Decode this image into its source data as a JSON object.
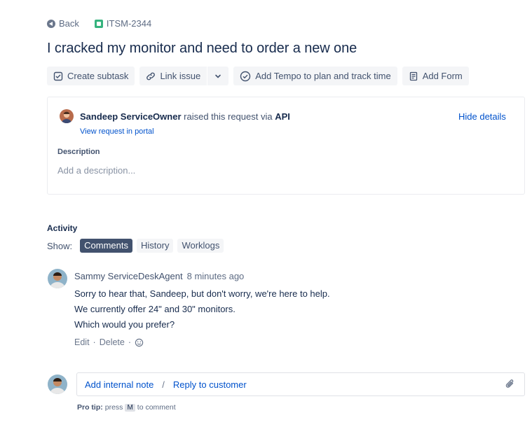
{
  "breadcrumb": {
    "back_label": "Back",
    "issue_key": "ITSM-2344"
  },
  "issue": {
    "title": "I cracked my monitor and need to order a new one"
  },
  "toolbar": {
    "create_subtask": "Create subtask",
    "link_issue": "Link issue",
    "add_tempo": "Add Tempo to plan and track time",
    "add_form": "Add Form"
  },
  "details": {
    "reporter": "Sandeep ServiceOwner",
    "raised_text": "raised this request via",
    "channel": "API",
    "view_portal": "View request in portal",
    "hide_details": "Hide details",
    "description_label": "Description",
    "description_placeholder": "Add a description..."
  },
  "activity": {
    "label": "Activity",
    "show_label": "Show:",
    "tabs": [
      "Comments",
      "History",
      "Worklogs"
    ],
    "active_tab": "Comments"
  },
  "comment": {
    "author": "Sammy ServiceDeskAgent",
    "time": "8 minutes ago",
    "lines": [
      "Sorry to hear that, Sandeep, but don't worry, we're here to help.",
      "We currently offer 24\" and 30\" monitors.",
      "Which would you prefer?"
    ],
    "edit": "Edit",
    "delete": "Delete",
    "sep": "·"
  },
  "reply": {
    "internal_note": "Add internal note",
    "separator": "/",
    "reply_customer": "Reply to customer",
    "protip_label": "Pro tip:",
    "protip_press": "press",
    "protip_key": "M",
    "protip_suffix": "to comment"
  },
  "colors": {
    "link": "#0052cc",
    "active_tab": "#42526e",
    "issue_type": "#36b37e"
  }
}
